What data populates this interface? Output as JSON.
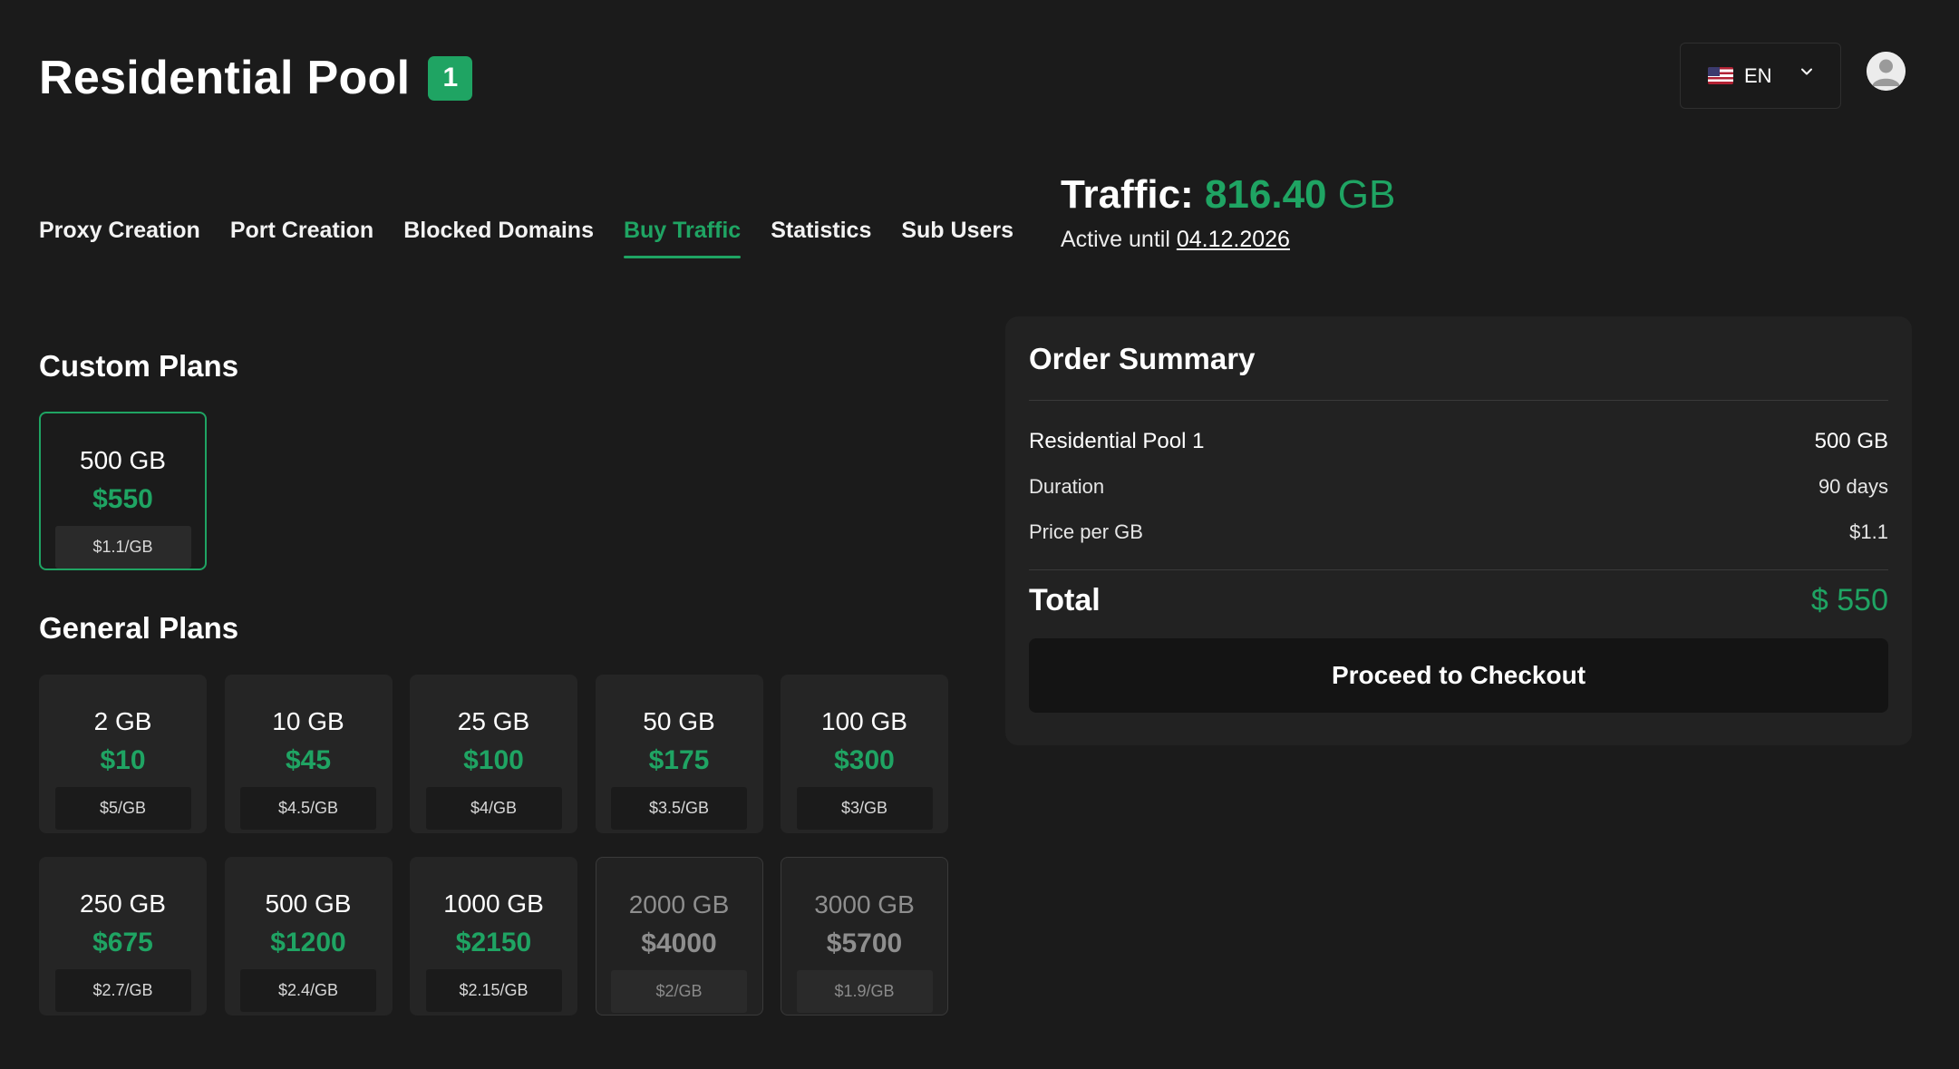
{
  "header": {
    "title": "Residential Pool",
    "badge": "1",
    "language": {
      "flag_icon": "us-flag-icon",
      "label": "EN"
    },
    "avatar_icon": "user-avatar-icon"
  },
  "tabs": [
    {
      "label": "Proxy Creation",
      "active": false
    },
    {
      "label": "Port Creation",
      "active": false
    },
    {
      "label": "Blocked Domains",
      "active": false
    },
    {
      "label": "Buy Traffic",
      "active": true
    },
    {
      "label": "Statistics",
      "active": false
    },
    {
      "label": "Sub Users",
      "active": false
    }
  ],
  "traffic": {
    "label": "Traffic:",
    "value": "816.40",
    "unit": "GB",
    "active_until_label": "Active until",
    "active_until_date": "04.12.2026"
  },
  "custom_plans": {
    "title": "Custom Plans",
    "plans": [
      {
        "size": "500 GB",
        "price": "$550",
        "per_gb": "$1.1/GB",
        "selected": true
      }
    ]
  },
  "general_plans": {
    "title": "General Plans",
    "plans": [
      {
        "size": "2 GB",
        "price": "$10",
        "per_gb": "$5/GB",
        "disabled": false
      },
      {
        "size": "10 GB",
        "price": "$45",
        "per_gb": "$4.5/GB",
        "disabled": false
      },
      {
        "size": "25 GB",
        "price": "$100",
        "per_gb": "$4/GB",
        "disabled": false
      },
      {
        "size": "50 GB",
        "price": "$175",
        "per_gb": "$3.5/GB",
        "disabled": false
      },
      {
        "size": "100 GB",
        "price": "$300",
        "per_gb": "$3/GB",
        "disabled": false
      },
      {
        "size": "250 GB",
        "price": "$675",
        "per_gb": "$2.7/GB",
        "disabled": false
      },
      {
        "size": "500 GB",
        "price": "$1200",
        "per_gb": "$2.4/GB",
        "disabled": false
      },
      {
        "size": "1000 GB",
        "price": "$2150",
        "per_gb": "$2.15/GB",
        "disabled": false
      },
      {
        "size": "2000 GB",
        "price": "$4000",
        "per_gb": "$2/GB",
        "disabled": true
      },
      {
        "size": "3000 GB",
        "price": "$5700",
        "per_gb": "$1.9/GB",
        "disabled": true
      }
    ]
  },
  "order_summary": {
    "title": "Order Summary",
    "rows": [
      {
        "label": "Residential Pool 1",
        "value": "500 GB"
      },
      {
        "label": "Duration",
        "value": "90 days"
      },
      {
        "label": "Price per GB",
        "value": "$1.1"
      }
    ],
    "total_label": "Total",
    "total_value": "$ 550",
    "checkout_label": "Proceed to Checkout"
  },
  "colors": {
    "background": "#1b1b1b",
    "accent": "#1fa463",
    "card": "#252525",
    "panel": "#222222"
  }
}
